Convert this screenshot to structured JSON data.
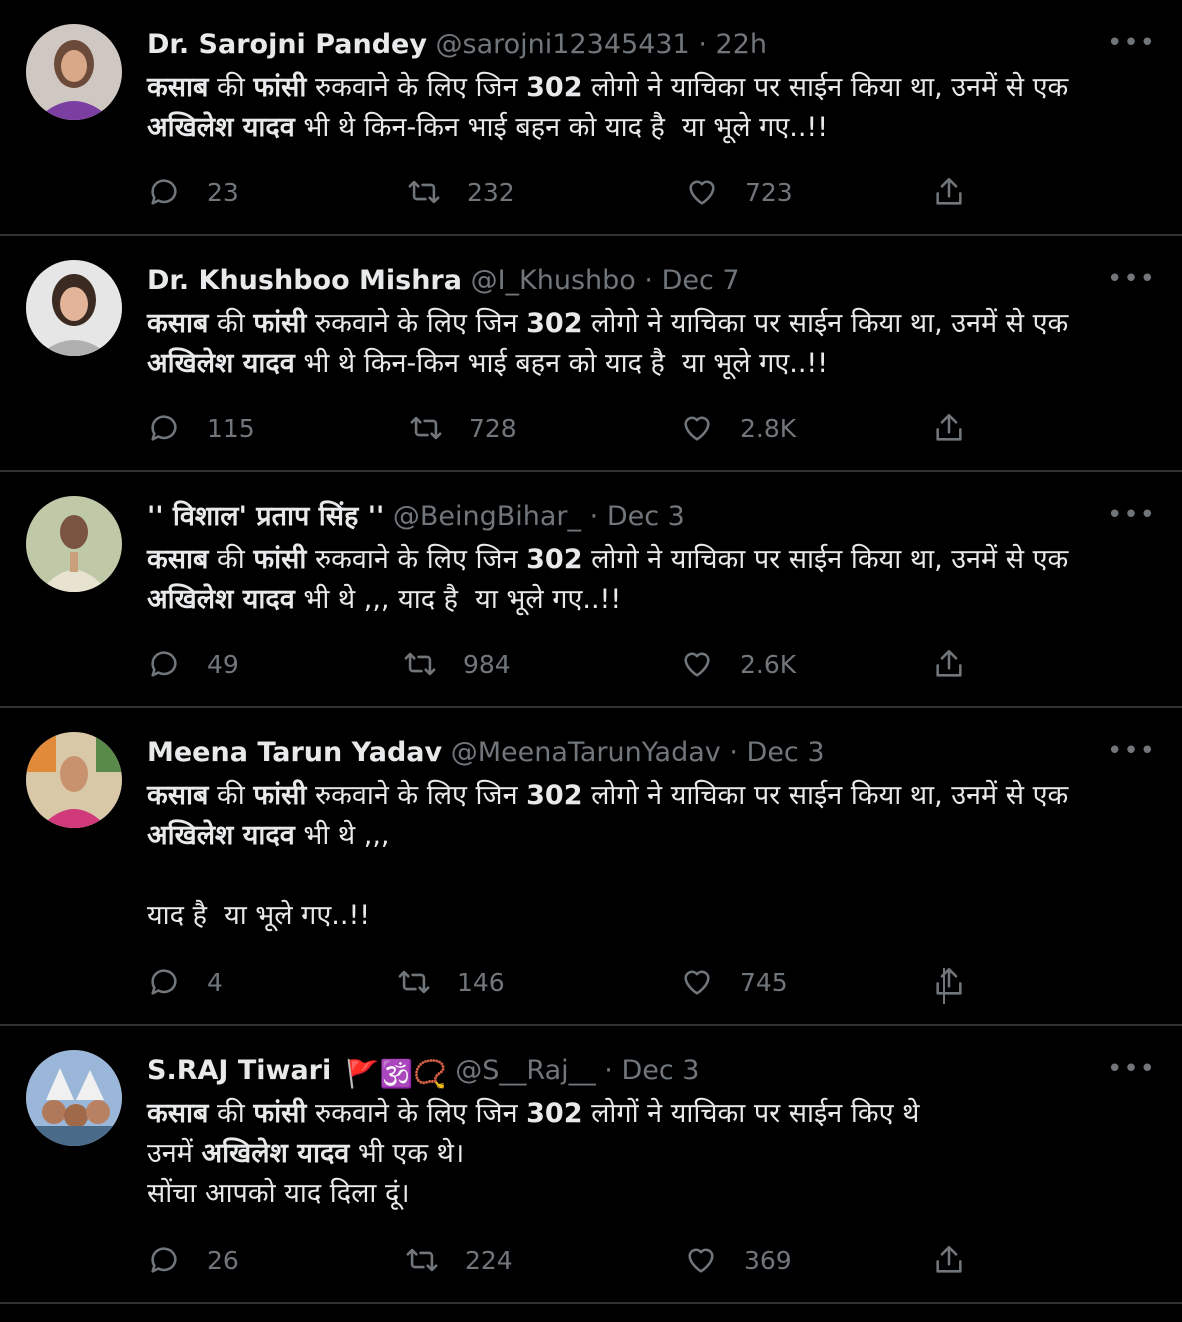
{
  "tweets": [
    {
      "name": "Dr. Sarojni Pandey",
      "handle": "@sarojni12345431",
      "sep": "·",
      "time": "22h",
      "body_bold_1": "कसाब",
      "body_1": " की ",
      "body_bold_2": "फांसी",
      "body_2": " रुकवाने के लिए जिन ",
      "body_bold_3": "302",
      "body_3": " लोगो ने याचिका पर साईन किया था, उनमें से एक\n",
      "body_bold_4": "अखिलेश यादव",
      "body_4": " भी थे किन-किन भाई बहन को याद है  या भूले गए..!!",
      "replies": "23",
      "retweets": "232",
      "likes": "723",
      "more_label": "•••"
    },
    {
      "name": "Dr. Khushboo Mishra",
      "handle": "@I_Khushbo",
      "sep": "·",
      "time": "Dec 7",
      "body_bold_1": "कसाब",
      "body_1": " की ",
      "body_bold_2": "फांसी",
      "body_2": " रुकवाने के लिए जिन ",
      "body_bold_3": "302",
      "body_3": " लोगो ने याचिका पर साईन किया था, उनमें से एक\n",
      "body_bold_4": "अखिलेश यादव",
      "body_4": " भी थे किन-किन भाई बहन को याद है  या भूले गए..!!",
      "replies": "115",
      "retweets": "728",
      "likes": "2.8K",
      "more_label": "•••"
    },
    {
      "name": "'' विशाल' प्रताप सिंह ''",
      "handle": "@BeingBihar_",
      "sep": "·",
      "time": "Dec 3",
      "body_bold_1": "कसाब",
      "body_1": " की ",
      "body_bold_2": "फांसी",
      "body_2": " रुकवाने के लिए जिन ",
      "body_bold_3": "302",
      "body_3": " लोगो ने याचिका पर साईन किया था, उनमें से एक\n",
      "body_bold_4": "अखिलेश यादव",
      "body_4": " भी थे ,,, याद है  या भूले गए..!!",
      "replies": "49",
      "retweets": "984",
      "likes": "2.6K",
      "more_label": "•••"
    },
    {
      "name": "Meena Tarun Yadav",
      "handle": "@MeenaTarunYadav",
      "sep": "·",
      "time": "Dec 3",
      "body_bold_1": "कसाब",
      "body_1": " की ",
      "body_bold_2": "फांसी",
      "body_2": " रुकवाने के लिए जिन ",
      "body_bold_3": "302",
      "body_3": " लोगो ने याचिका पर साईन किया था, उनमें से एक\n",
      "body_bold_4": "अखिलेश यादव",
      "body_4": " भी थे ,,,\n\nयाद है  या भूले गए..!!",
      "replies": "4",
      "retweets": "146",
      "likes": "745",
      "more_label": "•••"
    },
    {
      "name": "S.RAJ Tiwari",
      "emoji": "🚩🕉️📿",
      "handle": "@S__Raj__",
      "sep": "·",
      "time": "Dec 3",
      "body_bold_1": "कसाब",
      "body_1": " की ",
      "body_bold_2": "फांसी",
      "body_2": " रुकवाने के लिए जिन ",
      "body_bold_3": "302",
      "body_3": " लोगों ने याचिका पर साईन किए थे\nउनमें ",
      "body_bold_4": "अखिलेश यादव",
      "body_4": " भी एक थे।\nसोंचा आपको याद दिला दूं।",
      "replies": "26",
      "retweets": "224",
      "likes": "369",
      "more_label": "•••"
    }
  ],
  "icons": {
    "reply": "reply-icon",
    "retweet": "retweet-icon",
    "like": "heart-icon",
    "share": "share-icon",
    "more": "more-icon"
  },
  "colors": {
    "background": "#000000",
    "text": "#e7e9ea",
    "muted": "#71767b",
    "divider": "#2f3336"
  }
}
